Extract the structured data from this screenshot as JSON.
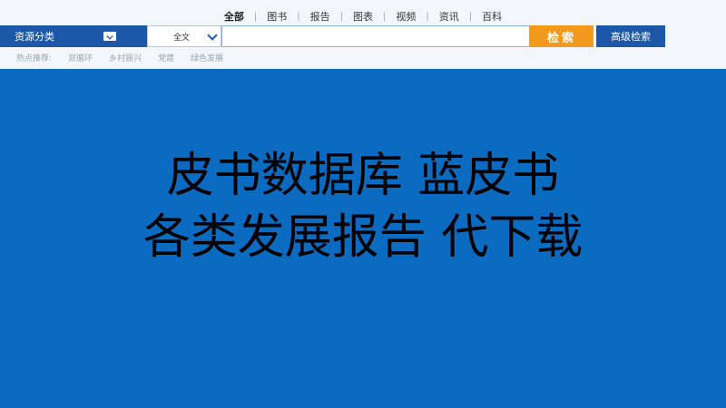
{
  "nav": {
    "tabs": [
      {
        "label": "全部",
        "active": true
      },
      {
        "label": "图书"
      },
      {
        "label": "报告"
      },
      {
        "label": "图表"
      },
      {
        "label": "视频"
      },
      {
        "label": "资讯"
      },
      {
        "label": "百科"
      }
    ],
    "separator": "|"
  },
  "search": {
    "category_label": "资源分类",
    "scope_value": "全文",
    "input_value": "",
    "button_label": "检索",
    "advanced_label": "高级检索"
  },
  "hot": {
    "label": "热点推荐:",
    "items": [
      "双循环",
      "乡村振兴",
      "党建",
      "绿色发展"
    ]
  },
  "headline": {
    "line1": "皮书数据库  蓝皮书",
    "line2": "各类发展报告  代下载"
  },
  "colors": {
    "background": "#0b6bc1",
    "topbar": "#f3f6fa",
    "brand_blue": "#1d57a7",
    "search_orange": "#f39a1e"
  }
}
